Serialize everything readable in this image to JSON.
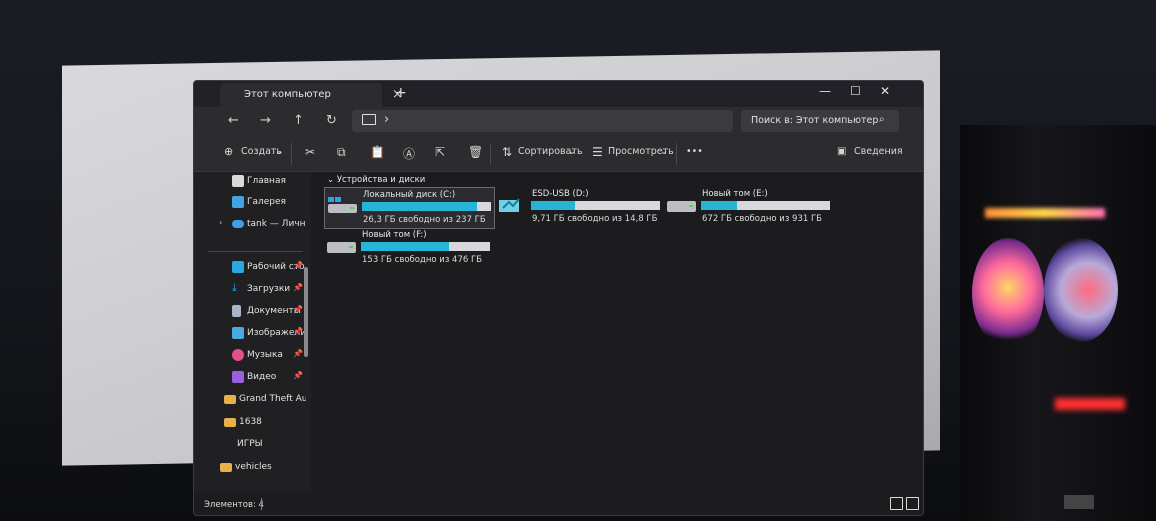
{
  "window": {
    "tab_title": "Этот компьютер",
    "tab_close": "×",
    "tab_add": "+",
    "minimize": "—",
    "maximize": "☐",
    "close": "✕"
  },
  "nav": {
    "back": "←",
    "forward": "→",
    "up": "↑",
    "refresh": "↻",
    "address_chevron": "›",
    "search_placeholder": "Поиск в: Этот компьютер"
  },
  "toolbar": {
    "create": "Создать",
    "sort": "Сортировать",
    "view": "Просмотреть",
    "more": "•••",
    "details": "Сведения"
  },
  "sidebar": {
    "items": [
      {
        "label": "Главная",
        "icon": "home-icon",
        "color": "#d9d9d9"
      },
      {
        "label": "Галерея",
        "icon": "gallery-icon",
        "color": "#3fa4e0"
      },
      {
        "label": "tank — Личное",
        "icon": "onedrive-icon",
        "color": "#3aa0ea"
      },
      {
        "label": "Рабочий стол",
        "icon": "desktop-icon",
        "color": "#2aa8e0",
        "pinned": true
      },
      {
        "label": "Загрузки",
        "icon": "download-icon",
        "color": "#2fa6e2",
        "pinned": true
      },
      {
        "label": "Документы",
        "icon": "documents-icon",
        "color": "#a9b6c6",
        "pinned": true
      },
      {
        "label": "Изображения",
        "icon": "pictures-icon",
        "color": "#4aa9e0",
        "pinned": true
      },
      {
        "label": "Музыка",
        "icon": "music-icon",
        "color": "#e0508a",
        "pinned": true
      },
      {
        "label": "Видео",
        "icon": "video-icon",
        "color": "#9b5fe0",
        "pinned": true
      },
      {
        "label": "Grand Theft Auto",
        "icon": "folder-icon",
        "color": "#e8b04a"
      },
      {
        "label": "1638",
        "icon": "folder-icon",
        "color": "#e8b04a"
      },
      {
        "label": "ИГРЫ",
        "icon": "folder-icon",
        "color": "#e8b04a"
      },
      {
        "label": "vehicles",
        "icon": "folder-icon",
        "color": "#e8b04a"
      }
    ]
  },
  "content": {
    "group_header": "Устройства и диски",
    "drives": [
      {
        "name": "Локальный диск (C:)",
        "free": "26,3 ГБ свободно из 237 ГБ",
        "used_fraction": 0.89,
        "selected": true
      },
      {
        "name": "ESD-USB (D:)",
        "free": "9,71 ГБ свободно из 14,8 ГБ",
        "used_fraction": 0.34,
        "selected": false
      },
      {
        "name": "Новый том (E:)",
        "free": "672 ГБ свободно из 931 ГБ",
        "used_fraction": 0.28,
        "selected": false
      },
      {
        "name": "Новый том (F:)",
        "free": "153 ГБ свободно из 476 ГБ",
        "used_fraction": 0.68,
        "selected": false
      }
    ]
  },
  "status": {
    "items_count": "Элементов: 4"
  },
  "colors": {
    "accent_bar": "#27b5d7",
    "window_bg": "#1c1c1e"
  }
}
